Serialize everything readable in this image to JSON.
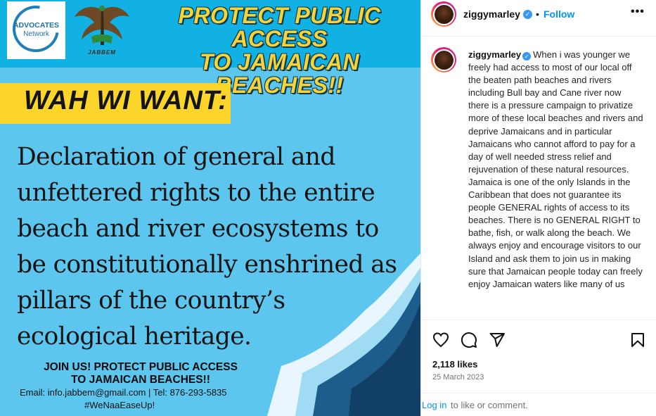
{
  "post_image": {
    "logo_advocates": {
      "line1": "ADVOCATES",
      "line2": "Network"
    },
    "logo_jabbem": {
      "caption": "JABBEM"
    },
    "headline": {
      "line1": "PROTECT PUBLIC ACCESS",
      "line2": "TO JAMAICAN BEACHES!!"
    },
    "banner": "WAH WI WANT:",
    "declaration": "Declaration of general and unfettered rights to the entire beach and river ecosystems to be constitutionally enshrined as pillars of the country’s ecological heritage.",
    "join": {
      "line1": "JOIN US! PROTECT PUBLIC ACCESS",
      "line2": "TO JAMAICAN BEACHES!!"
    },
    "contact": "Email: info.jabbem@gmail.com | Tel: 876-293-5835",
    "hashtag": "#WeNaaEaseUp!",
    "colors": {
      "background": "#5cc6ee",
      "banner": "#fbd52a",
      "headline": "#f6d33b",
      "wave_dark": "#1c5d8c"
    }
  },
  "post_header": {
    "username": "ziggymarley",
    "separator": "•",
    "follow_label": "Follow",
    "more_label": "•••"
  },
  "caption": {
    "username": "ziggymarley",
    "text": "When i was younger we freely had access to most of our local off the beaten path beaches and rivers including Bull bay and Cane river now there is a pressure campaign to privatize more of these local beaches and rivers and deprive Jamaicans and in particular Jamaicans who cannot afford to pay for a day of well needed stress relief and rejuvenation of these natural resources.\nJamaica is one of the only Islands in the Caribbean that does not guarantee its people GENERAL rights of access to its beaches. There is no GENERAL RIGHT to bathe, fish, or walk along the beach. We always enjoy and encourage visitors to our Island and ask them to join us in making sure that Jamaican people today can freely enjoy Jamaican waters like many of us"
  },
  "actions": {
    "icons": [
      "heart-icon",
      "comment-icon",
      "share-icon",
      "bookmark-icon"
    ],
    "likes": "2,118 likes",
    "date": "25 March 2023"
  },
  "login": {
    "link": "Log in",
    "rest": "to like or comment."
  },
  "colors": {
    "accent": "#0095f6",
    "verified": "#3897f0"
  }
}
